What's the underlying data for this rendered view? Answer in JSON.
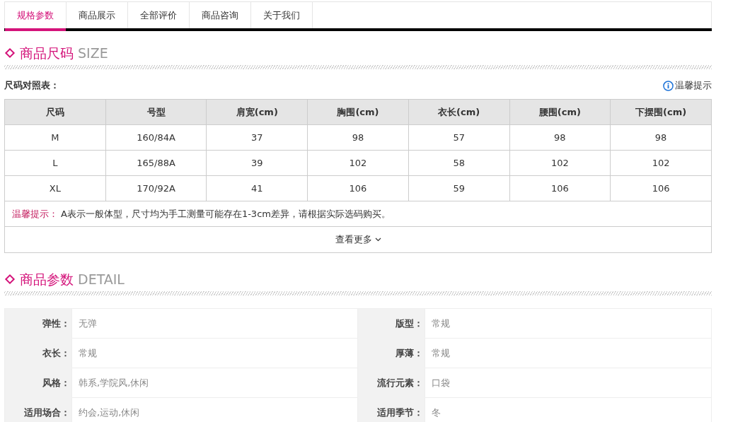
{
  "tabs": [
    {
      "label": "规格参数",
      "selected": true
    },
    {
      "label": "商品展示",
      "selected": false
    },
    {
      "label": "全部评价",
      "selected": false
    },
    {
      "label": "商品咨询",
      "selected": false
    },
    {
      "label": "关于我们",
      "selected": false
    }
  ],
  "size_section": {
    "title": "商品尺码",
    "subtitle": "SIZE",
    "table_caption": "尺码对照表：",
    "tip_link": "温馨提示",
    "table": {
      "columns": [
        "尺码",
        "号型",
        "肩宽(cm)",
        "胸围(cm)",
        "衣长(cm)",
        "腰围(cm)",
        "下摆围(cm)"
      ],
      "rows": [
        [
          "M",
          "160/84A",
          "37",
          "98",
          "57",
          "98",
          "98"
        ],
        [
          "L",
          "165/88A",
          "39",
          "102",
          "58",
          "102",
          "102"
        ],
        [
          "XL",
          "170/92A",
          "41",
          "106",
          "59",
          "106",
          "106"
        ]
      ]
    },
    "note_label": "温馨提示：",
    "note_text": "A表示一般体型，尺寸均为手工测量可能存在1-3cm差异，请根据实际选码购买。",
    "more_button": "查看更多"
  },
  "detail_section": {
    "title": "商品参数",
    "subtitle": "DETAIL",
    "params": [
      {
        "label": "弹性：",
        "value": "无弹"
      },
      {
        "label": "版型：",
        "value": "常规"
      },
      {
        "label": "衣长：",
        "value": "常规"
      },
      {
        "label": "厚薄：",
        "value": "常规"
      },
      {
        "label": "风格：",
        "value": "韩系,学院风,休闲"
      },
      {
        "label": "流行元素：",
        "value": "口袋"
      },
      {
        "label": "适用场合：",
        "value": "约会,运动,休闲"
      },
      {
        "label": "适用季节：",
        "value": "冬"
      }
    ]
  }
}
